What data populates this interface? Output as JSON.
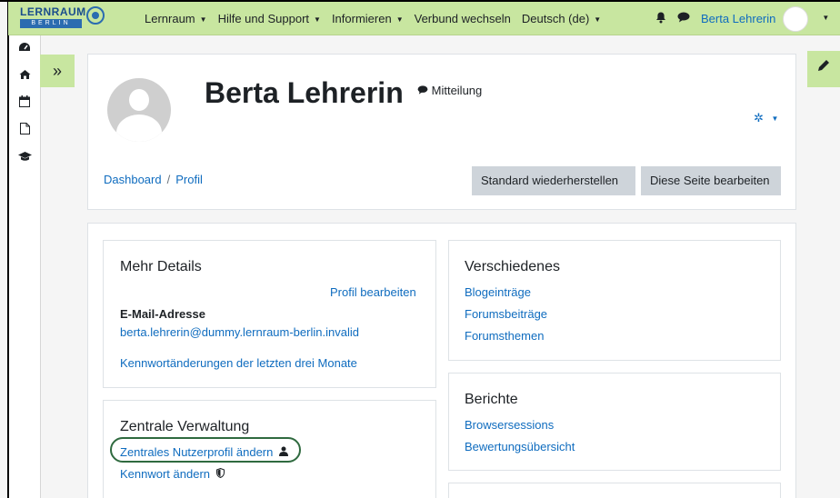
{
  "navbar": {
    "logo_text": "LERNRAUM",
    "logo_sub": "BERLIN",
    "menu": [
      {
        "label": "Lernraum",
        "has_caret": true
      },
      {
        "label": "Hilfe und Support",
        "has_caret": true
      },
      {
        "label": "Informieren",
        "has_caret": true
      },
      {
        "label": "Verbund wechseln",
        "has_caret": false
      },
      {
        "label": "Deutsch (de)",
        "has_caret": true
      }
    ],
    "notification_icon": "bell-icon",
    "message_icon": "comment-icon",
    "user_name": "Berta Lehrerin"
  },
  "sidebar": {
    "icons": [
      "dashboard-icon",
      "home-icon",
      "calendar-icon",
      "file-icon",
      "graduation-cap-icon"
    ]
  },
  "header": {
    "user_title": "Berta Lehrerin",
    "message_label": "Mitteilung",
    "breadcrumb": [
      "Dashboard",
      "Profil"
    ],
    "reset_button": "Standard wiederherstellen",
    "edit_button": "Diese Seite bearbeiten"
  },
  "details": {
    "title": "Mehr Details",
    "edit_profile": "Profil bearbeiten",
    "email_label": "E-Mail-Adresse",
    "email_value": "berta.lehrerin@dummy.lernraum-berlin.invalid",
    "password_changes": "Kennwortänderungen der letzten drei Monate"
  },
  "admin": {
    "title": "Zentrale Verwaltung",
    "profile_link": "Zentrales Nutzerprofil ändern",
    "password_link": "Kennwort ändern"
  },
  "misc": {
    "title": "Verschiedenes",
    "links": [
      "Blogeinträge",
      "Forumsbeiträge",
      "Forumsthemen"
    ]
  },
  "reports": {
    "title": "Berichte",
    "links": [
      "Browsersessions",
      "Bewertungsübersicht"
    ]
  },
  "colors": {
    "navbar": "#c8e6a0",
    "link": "#0f6cbf",
    "highlight": "#2f6a3f"
  }
}
